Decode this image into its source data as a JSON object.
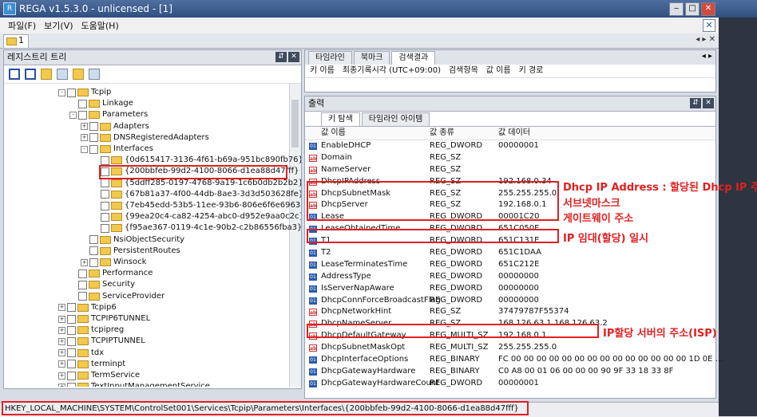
{
  "window": {
    "title": "REGA v1.5.3.0 - unlicensed - [1]"
  },
  "menu": [
    "파일(F)",
    "보기(V)",
    "도움말(H)"
  ],
  "doc_tab": {
    "label": "1"
  },
  "left_panel": {
    "title": "레지스트리 트리",
    "tree": [
      {
        "label": "Tcpip",
        "lvl": 0,
        "exp": "-"
      },
      {
        "label": "Linkage",
        "lvl": 1,
        "exp": ""
      },
      {
        "label": "Parameters",
        "lvl": 1,
        "exp": "-"
      },
      {
        "label": "Adapters",
        "lvl": 2,
        "exp": "+"
      },
      {
        "label": "DNSRegisteredAdapters",
        "lvl": 2,
        "exp": "+"
      },
      {
        "label": "Interfaces",
        "lvl": 2,
        "exp": "-"
      },
      {
        "label": "{0d615417-3136-4f61-b69a-951bc890fb76}",
        "lvl": 3,
        "exp": ""
      },
      {
        "label": "{200bbfeb-99d2-4100-8066-d1ea88d47fff}",
        "lvl": 3,
        "exp": ""
      },
      {
        "label": "{5ddff285-0197-4768-9a19-1c6b0db2b2b2}",
        "lvl": 3,
        "exp": ""
      },
      {
        "label": "{67b81a37-4f00-44db-8ae3-3d3d503628fe}",
        "lvl": 3,
        "exp": ""
      },
      {
        "label": "{7eb45edd-53b5-11ee-93b6-806e6f6e6963}",
        "lvl": 3,
        "exp": ""
      },
      {
        "label": "{99ea20c4-ca82-4254-abc0-d952e9aa0c2c}",
        "lvl": 3,
        "exp": ""
      },
      {
        "label": "{f95ae367-0119-4c1e-90b2-c2b86556fba3}",
        "lvl": 3,
        "exp": ""
      },
      {
        "label": "NsiObjectSecurity",
        "lvl": 2,
        "exp": ""
      },
      {
        "label": "PersistentRoutes",
        "lvl": 2,
        "exp": ""
      },
      {
        "label": "Winsock",
        "lvl": 2,
        "exp": "+"
      },
      {
        "label": "Performance",
        "lvl": 1,
        "exp": ""
      },
      {
        "label": "Security",
        "lvl": 1,
        "exp": ""
      },
      {
        "label": "ServiceProvider",
        "lvl": 1,
        "exp": ""
      },
      {
        "label": "Tcpip6",
        "lvl": 0,
        "exp": "+"
      },
      {
        "label": "TCPIP6TUNNEL",
        "lvl": 0,
        "exp": "+"
      },
      {
        "label": "tcpipreg",
        "lvl": 0,
        "exp": "+"
      },
      {
        "label": "TCPIPTUNNEL",
        "lvl": 0,
        "exp": "+"
      },
      {
        "label": "tdx",
        "lvl": 0,
        "exp": "+"
      },
      {
        "label": "terminpt",
        "lvl": 0,
        "exp": "+"
      },
      {
        "label": "TermService",
        "lvl": 0,
        "exp": "+"
      },
      {
        "label": "TextInputManagementService",
        "lvl": 0,
        "exp": "+"
      }
    ]
  },
  "right_top": {
    "tabs": [
      "타임라인",
      "북마크",
      "검색결과"
    ],
    "active_tab": 2,
    "columns": [
      "키 이름",
      "최종기록시각 (UTC+09:00)",
      "검색항목",
      "값 이름",
      "키 경로"
    ]
  },
  "right_bottom": {
    "title": "출력",
    "subtabs": [
      "키 탐색",
      "타임라인 아이템"
    ],
    "columns": [
      "값 이름",
      "값 종류",
      "값 데이터"
    ],
    "rows": [
      {
        "name": "EnableDHCP",
        "type": "REG_DWORD",
        "data": "00000001",
        "icon": "bin"
      },
      {
        "name": "Domain",
        "type": "REG_SZ",
        "data": "",
        "icon": "ab"
      },
      {
        "name": "NameServer",
        "type": "REG_SZ",
        "data": "",
        "icon": "ab"
      },
      {
        "name": "DhcpIPAddress",
        "type": "REG_SZ",
        "data": "192.168.0.34",
        "icon": "ab"
      },
      {
        "name": "DhcpSubnetMask",
        "type": "REG_SZ",
        "data": "255.255.255.0",
        "icon": "ab"
      },
      {
        "name": "DhcpServer",
        "type": "REG_SZ",
        "data": "192.168.0.1",
        "icon": "ab"
      },
      {
        "name": "Lease",
        "type": "REG_DWORD",
        "data": "00001C20",
        "icon": "bin"
      },
      {
        "name": "LeaseObtainedTime",
        "type": "REG_DWORD",
        "data": "651C050E",
        "icon": "bin"
      },
      {
        "name": "T1",
        "type": "REG_DWORD",
        "data": "651C131E",
        "icon": "bin"
      },
      {
        "name": "T2",
        "type": "REG_DWORD",
        "data": "651C1DAA",
        "icon": "bin"
      },
      {
        "name": "LeaseTerminatesTime",
        "type": "REG_DWORD",
        "data": "651C212E",
        "icon": "bin"
      },
      {
        "name": "AddressType",
        "type": "REG_DWORD",
        "data": "00000000",
        "icon": "bin"
      },
      {
        "name": "IsServerNapAware",
        "type": "REG_DWORD",
        "data": "00000000",
        "icon": "bin"
      },
      {
        "name": "DhcpConnForceBroadcastFlag",
        "type": "REG_DWORD",
        "data": "00000000",
        "icon": "bin"
      },
      {
        "name": "DhcpNetworkHint",
        "type": "REG_SZ",
        "data": "37479787F55374",
        "icon": "ab"
      },
      {
        "name": "DhcpNameServer",
        "type": "REG_SZ",
        "data": "168.126.63.1 168.126.63.2",
        "icon": "ab"
      },
      {
        "name": "DhcpDefaultGateway",
        "type": "REG_MULTI_SZ",
        "data": "192.168.0.1",
        "icon": "ab"
      },
      {
        "name": "DhcpSubnetMaskOpt",
        "type": "REG_MULTI_SZ",
        "data": "255.255.255.0",
        "icon": "ab"
      },
      {
        "name": "DhcpInterfaceOptions",
        "type": "REG_BINARY",
        "data": "FC 00 00 00 00 00 00 00 00 00 00 00 00 00 00 1D 0E ...",
        "icon": "bin"
      },
      {
        "name": "DhcpGatewayHardware",
        "type": "REG_BINARY",
        "data": "C0 A8 00 01 06 00 00 00 90 9F 33 18 33 8F",
        "icon": "bin"
      },
      {
        "name": "DhcpGatewayHardwareCount",
        "type": "REG_DWORD",
        "data": "00000001",
        "icon": "bin"
      }
    ]
  },
  "annotations": {
    "dhcp_ip": "Dhcp IP Address : 할당된 Dhcp IP 주소",
    "subnet": "서브넷마스크",
    "gateway": "게이트웨이 주소",
    "lease_time": "IP 임대(할당) 일시",
    "name_server": "IP할당 서버의 주소(ISP)"
  },
  "status_path": "HKEY_LOCAL_MACHINE\\SYSTEM\\ControlSet001\\Services\\Tcpip\\Parameters\\Interfaces\\{200bbfeb-99d2-4100-8066-d1ea88d47fff}",
  "colors": {
    "annotation": "#e02020",
    "title_bar": "#2f4f7f"
  }
}
